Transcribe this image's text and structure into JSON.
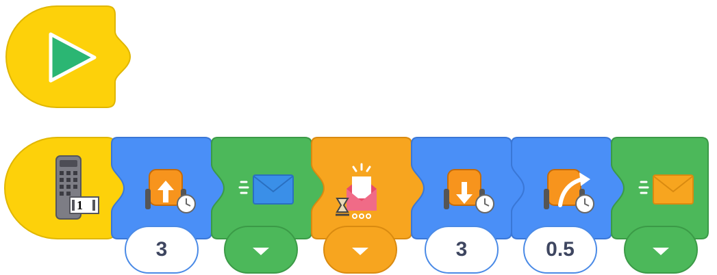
{
  "program": {
    "start_block": {
      "icon": "play-icon",
      "color": "#fdd10a"
    },
    "stack": [
      {
        "type": "remote-control-trigger",
        "icon": "remote-control-icon",
        "channel": "1",
        "color": "#fdd10a"
      },
      {
        "type": "move-forward-seconds",
        "icon": "drive-forward-timer-icon",
        "value": "3",
        "color": "#4a8ff7"
      },
      {
        "type": "send-message",
        "icon": "blue-envelope-icon",
        "dropdown": true,
        "color": "#4cb85a"
      },
      {
        "type": "wait-for-message",
        "icon": "wait-message-hourglass-icon",
        "dropdown": true,
        "color": "#f7a51f"
      },
      {
        "type": "move-backward-seconds",
        "icon": "drive-backward-timer-icon",
        "value": "3",
        "color": "#4a8ff7"
      },
      {
        "type": "spin-right-seconds",
        "icon": "spin-right-timer-icon",
        "value": "0.5",
        "color": "#4a8ff7"
      },
      {
        "type": "send-message",
        "icon": "orange-envelope-icon",
        "dropdown": true,
        "color": "#4cb85a"
      }
    ]
  }
}
